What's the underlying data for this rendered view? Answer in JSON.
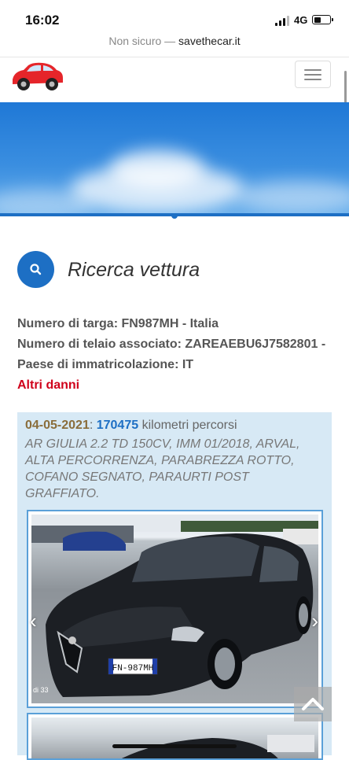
{
  "status_bar": {
    "time": "16:02",
    "network": "4G"
  },
  "browser": {
    "security": "Non sicuro —",
    "domain": "savethecar.it"
  },
  "nav": {
    "logo_icon": "red-car-icon",
    "menu_icon": "hamburger-icon"
  },
  "page": {
    "title": "Ricerca vettura",
    "search_icon": "search-icon"
  },
  "vehicle": {
    "plate_label": "Numero di targa:",
    "plate_value": "FN987MH - Italia",
    "vin_label": "Numero di telaio associato:",
    "vin_value": "ZAREAEBU6J7582801 -",
    "country_label": "Paese di immatricolazione:",
    "country_value": "IT",
    "damage_link": "Altri danni"
  },
  "record": {
    "date": "04-05-2021",
    "km": "170475",
    "km_suffix": "kilometri percorsi",
    "description": "AR GIULIA 2.2 TD 150CV, IMM 01/2018, ARVAL, ALTA PERCORRENZA, PARABREZZA ROTTO, COFANO SEGNATO, PARAURTI POST GRAFFIATO.",
    "photo_counter": "di 33",
    "plate_on_car": "FN-987MH",
    "prev_icon": "chevron-left-icon",
    "next_icon": "chevron-right-icon"
  },
  "scroll_top_icon": "chevron-up-icon",
  "colors": {
    "accent": "#1d6fc4",
    "damage": "#d0021b",
    "record_bg": "#d7e9f5"
  }
}
